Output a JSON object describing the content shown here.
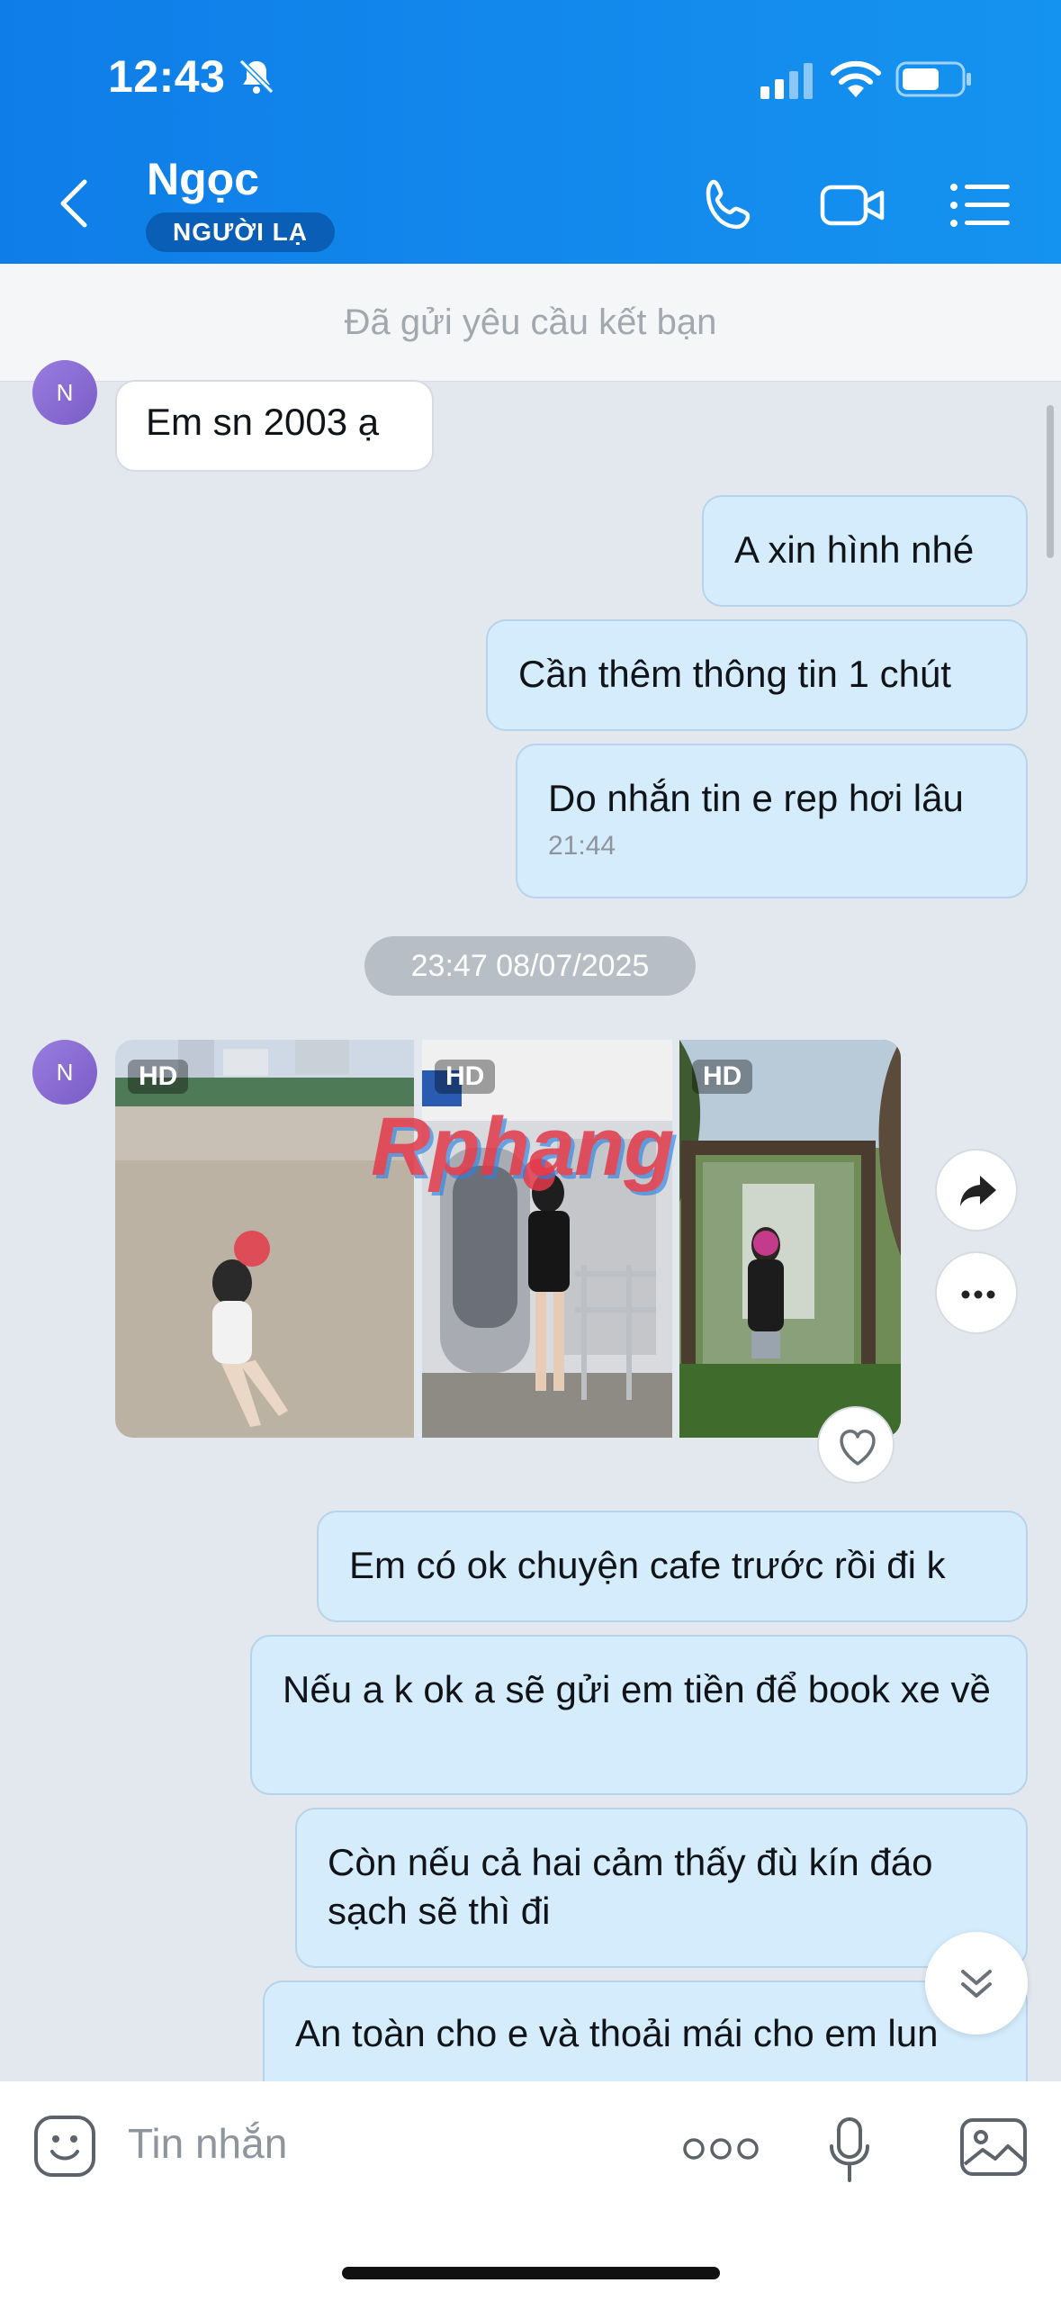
{
  "status_bar": {
    "time": "12:43"
  },
  "header": {
    "contact_name": "Ngọc",
    "badge": "NGƯỜI LẠ"
  },
  "friend_banner": "Đã gửi yêu cầu kết bạn",
  "avatar_initial": "N",
  "messages": [
    {
      "dir": "in",
      "text": "Em sn 2003 ạ"
    },
    {
      "dir": "out",
      "text": "A xin hình nhé"
    },
    {
      "dir": "out",
      "text": "Cần thêm thông tin 1 chút"
    },
    {
      "dir": "out",
      "text": "Do nhắn tin e rep hơi lâu",
      "time": "21:44"
    },
    {
      "dir": "out",
      "text": "Em có ok chuyện cafe trước rồi đi k"
    },
    {
      "dir": "out",
      "text": "Nếu a k ok a sẽ gửi em tiền để book xe về"
    },
    {
      "dir": "out",
      "text": "Còn nếu cả hai cảm thấy đù kín đáo sạch sẽ thì đi"
    },
    {
      "dir": "out",
      "text": "An toàn cho e và thoải mái cho em lun"
    }
  ],
  "date_separator": "23:47 08/07/2025",
  "photos": [
    {
      "badge": "HD"
    },
    {
      "badge": "HD"
    },
    {
      "badge": "HD"
    }
  ],
  "watermark": "Rphang",
  "composer": {
    "placeholder": "Tin nhắn"
  },
  "colors": {
    "header": "#1593f0",
    "outgoing_bubble": "#d4ecfc",
    "background": "#e3e8ef"
  }
}
